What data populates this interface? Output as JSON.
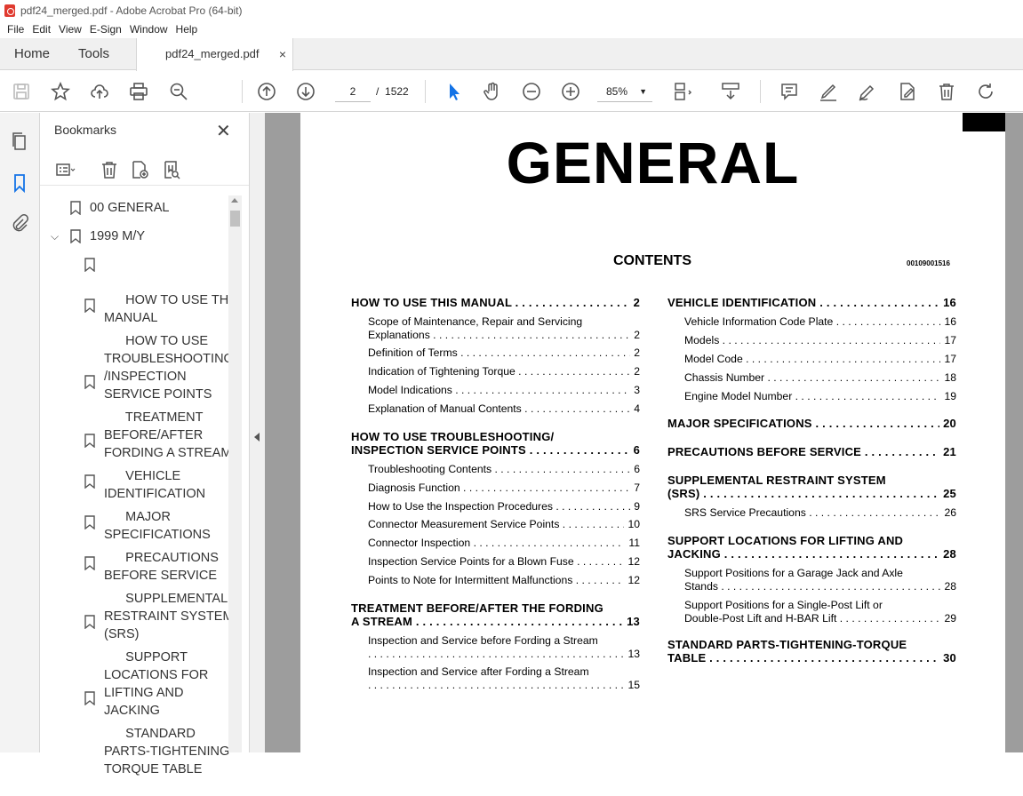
{
  "window": {
    "title": "pdf24_merged.pdf - Adobe Acrobat Pro (64-bit)"
  },
  "menu": [
    "File",
    "Edit",
    "View",
    "E-Sign",
    "Window",
    "Help"
  ],
  "tabs": {
    "home": "Home",
    "tools": "Tools",
    "doc": "pdf24_merged.pdf",
    "close": "×"
  },
  "toolbar": {
    "page_current": "2",
    "page_sep": "/",
    "page_total": "1522",
    "zoom": "85%"
  },
  "bookmarks": {
    "title": "Bookmarks",
    "items": [
      {
        "label": "00 GENERAL"
      },
      {
        "label": "1999 M/Y"
      },
      {
        "label": "HOW TO USE THIS\nMANUAL"
      },
      {
        "label": "HOW TO USE\nTROUBLESHOOTING\n/INSPECTION\nSERVICE POINTS"
      },
      {
        "label": "TREATMENT\nBEFORE/AFTER\nFORDING A STREAM"
      },
      {
        "label": "VEHICLE\nIDENTIFICATION"
      },
      {
        "label": "MAJOR\nSPECIFICATIONS"
      },
      {
        "label": "PRECAUTIONS\nBEFORE SERVICE"
      },
      {
        "label": "SUPPLEMENTAL\nRESTRAINT SYSTEM\n(SRS)"
      },
      {
        "label": "SUPPORT\nLOCATIONS FOR\nLIFTING AND\nJACKING"
      },
      {
        "label": "STANDARD\nPARTS-TIGHTENING-\nTORQUE TABLE"
      }
    ]
  },
  "page": {
    "title": "GENERAL",
    "contents": "CONTENTS",
    "code": "00109001516",
    "left_col": [
      {
        "type": "h",
        "lines": [
          "HOW TO USE THIS MANUAL"
        ],
        "page": "2"
      },
      {
        "type": "s",
        "lines": [
          "Scope of Maintenance, Repair and Servicing",
          "Explanations"
        ],
        "page": "2"
      },
      {
        "type": "s",
        "lines": [
          "Definition of Terms"
        ],
        "page": "2"
      },
      {
        "type": "s",
        "lines": [
          "Indication of Tightening Torque"
        ],
        "page": "2"
      },
      {
        "type": "s",
        "lines": [
          "Model Indications"
        ],
        "page": "3"
      },
      {
        "type": "s",
        "lines": [
          "Explanation of Manual Contents"
        ],
        "page": "4"
      },
      {
        "type": "h",
        "lines": [
          "HOW TO USE TROUBLESHOOTING/",
          "INSPECTION SERVICE POINTS"
        ],
        "page": "6"
      },
      {
        "type": "s",
        "lines": [
          "Troubleshooting Contents"
        ],
        "page": "6"
      },
      {
        "type": "s",
        "lines": [
          "Diagnosis Function"
        ],
        "page": "7"
      },
      {
        "type": "s",
        "lines": [
          "How to Use the Inspection Procedures"
        ],
        "page": "9"
      },
      {
        "type": "s",
        "lines": [
          "Connector Measurement Service Points"
        ],
        "page": "10"
      },
      {
        "type": "s",
        "lines": [
          "Connector Inspection"
        ],
        "page": "11"
      },
      {
        "type": "s",
        "lines": [
          "Inspection Service Points for a Blown Fuse"
        ],
        "page": "12"
      },
      {
        "type": "s",
        "lines": [
          "Points to Note for Intermittent Malfunctions"
        ],
        "page": "12"
      },
      {
        "type": "h",
        "lines": [
          "TREATMENT BEFORE/AFTER THE FORDING",
          "A STREAM"
        ],
        "page": "13"
      },
      {
        "type": "s",
        "lines": [
          "Inspection and Service before Fording a Stream",
          ""
        ],
        "page": "13"
      },
      {
        "type": "s",
        "lines": [
          "Inspection and Service after Fording a Stream",
          ""
        ],
        "page": "15"
      }
    ],
    "right_col": [
      {
        "type": "h",
        "lines": [
          "VEHICLE IDENTIFICATION"
        ],
        "page": "16"
      },
      {
        "type": "s",
        "lines": [
          "Vehicle Information Code Plate"
        ],
        "page": "16"
      },
      {
        "type": "s",
        "lines": [
          "Models"
        ],
        "page": "17"
      },
      {
        "type": "s",
        "lines": [
          "Model Code"
        ],
        "page": "17"
      },
      {
        "type": "s",
        "lines": [
          "Chassis Number"
        ],
        "page": "18"
      },
      {
        "type": "s",
        "lines": [
          "Engine Model Number"
        ],
        "page": "19"
      },
      {
        "type": "h",
        "lines": [
          "MAJOR SPECIFICATIONS"
        ],
        "page": "20"
      },
      {
        "type": "h",
        "lines": [
          "PRECAUTIONS BEFORE SERVICE"
        ],
        "page": "21"
      },
      {
        "type": "h",
        "lines": [
          "SUPPLEMENTAL RESTRAINT SYSTEM",
          "(SRS)"
        ],
        "page": "25"
      },
      {
        "type": "s",
        "lines": [
          "SRS Service Precautions"
        ],
        "page": "26"
      },
      {
        "type": "h",
        "lines": [
          "SUPPORT LOCATIONS FOR LIFTING AND",
          "JACKING"
        ],
        "page": "28"
      },
      {
        "type": "s",
        "lines": [
          "Support Positions for a Garage Jack and Axle",
          "Stands"
        ],
        "page": "28"
      },
      {
        "type": "s",
        "lines": [
          "Support Positions for a Single-Post Lift or",
          "Double-Post Lift and H-BAR Lift"
        ],
        "page": "29"
      },
      {
        "type": "h",
        "lines": [
          "STANDARD PARTS-TIGHTENING-TORQUE",
          "TABLE"
        ],
        "page": "30"
      }
    ]
  }
}
